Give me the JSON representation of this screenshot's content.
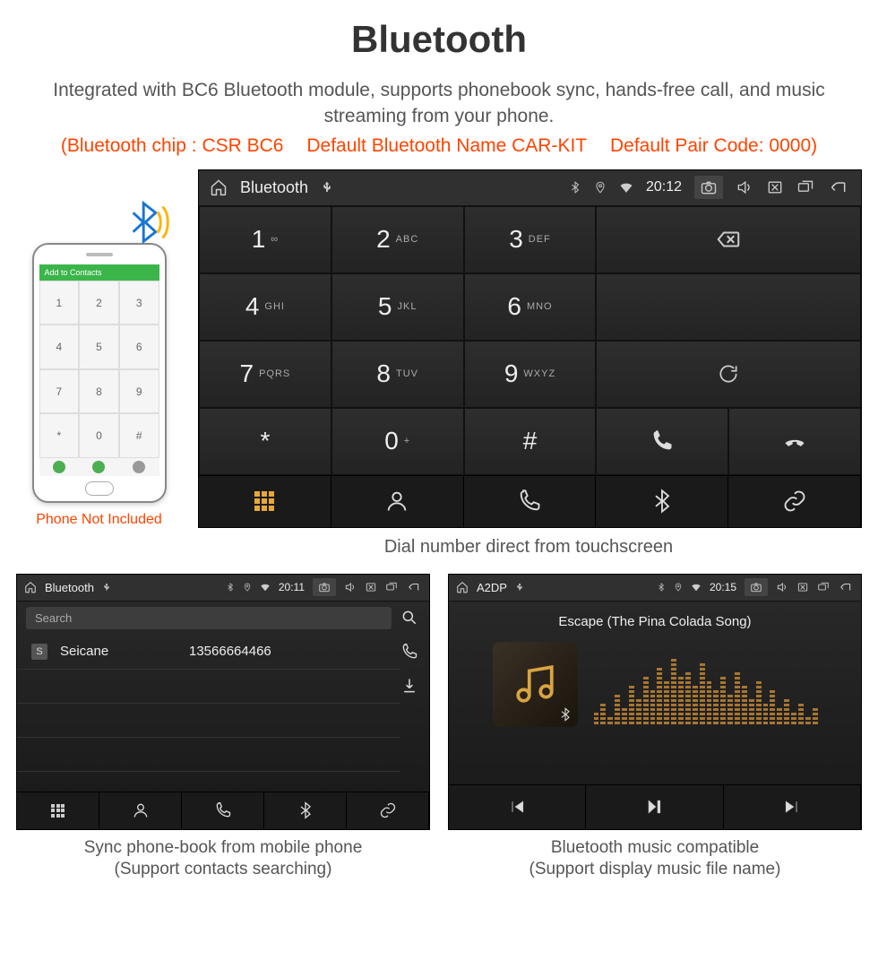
{
  "title": "Bluetooth",
  "subtitle": "Integrated with BC6 Bluetooth module, supports phonebook sync, hands-free call, and music streaming from your phone.",
  "specs": {
    "chip": "(Bluetooth chip : CSR BC6",
    "name": "Default Bluetooth Name CAR-KIT",
    "pair": "Default Pair Code: 0000)"
  },
  "phone": {
    "screen_header": "Add to Contacts",
    "keys": [
      "1",
      "2",
      "3",
      "4",
      "5",
      "6",
      "7",
      "8",
      "9",
      "*",
      "0",
      "#"
    ],
    "note": "Phone Not Included"
  },
  "unit_main": {
    "statusbar": {
      "title": "Bluetooth",
      "time": "20:12"
    },
    "dialpad": [
      {
        "n": "1",
        "s": "∞"
      },
      {
        "n": "2",
        "s": "ABC"
      },
      {
        "n": "3",
        "s": "DEF"
      },
      {
        "n": "4",
        "s": "GHI"
      },
      {
        "n": "5",
        "s": "JKL"
      },
      {
        "n": "6",
        "s": "MNO"
      },
      {
        "n": "7",
        "s": "PQRS"
      },
      {
        "n": "8",
        "s": "TUV"
      },
      {
        "n": "9",
        "s": "WXYZ"
      },
      {
        "n": "*",
        "s": ""
      },
      {
        "n": "0",
        "s": "+"
      },
      {
        "n": "#",
        "s": ""
      }
    ],
    "caption": "Dial number direct from touchscreen"
  },
  "unit_contacts": {
    "statusbar": {
      "title": "Bluetooth",
      "time": "20:11"
    },
    "search_placeholder": "Search",
    "contact": {
      "badge": "S",
      "name": "Seicane",
      "number": "13566664466"
    },
    "caption_l1": "Sync phone-book from mobile phone",
    "caption_l2": "(Support contacts searching)"
  },
  "unit_music": {
    "statusbar": {
      "title": "A2DP",
      "time": "20:15"
    },
    "track": "Escape (The Pina Colada Song)",
    "viz_heights": [
      15,
      25,
      10,
      35,
      20,
      45,
      30,
      55,
      40,
      65,
      50,
      75,
      55,
      60,
      45,
      70,
      50,
      40,
      55,
      35,
      60,
      45,
      30,
      50,
      25,
      40,
      20,
      30,
      15,
      25,
      10,
      20
    ],
    "caption_l1": "Bluetooth music compatible",
    "caption_l2": "(Support display music file name)"
  }
}
